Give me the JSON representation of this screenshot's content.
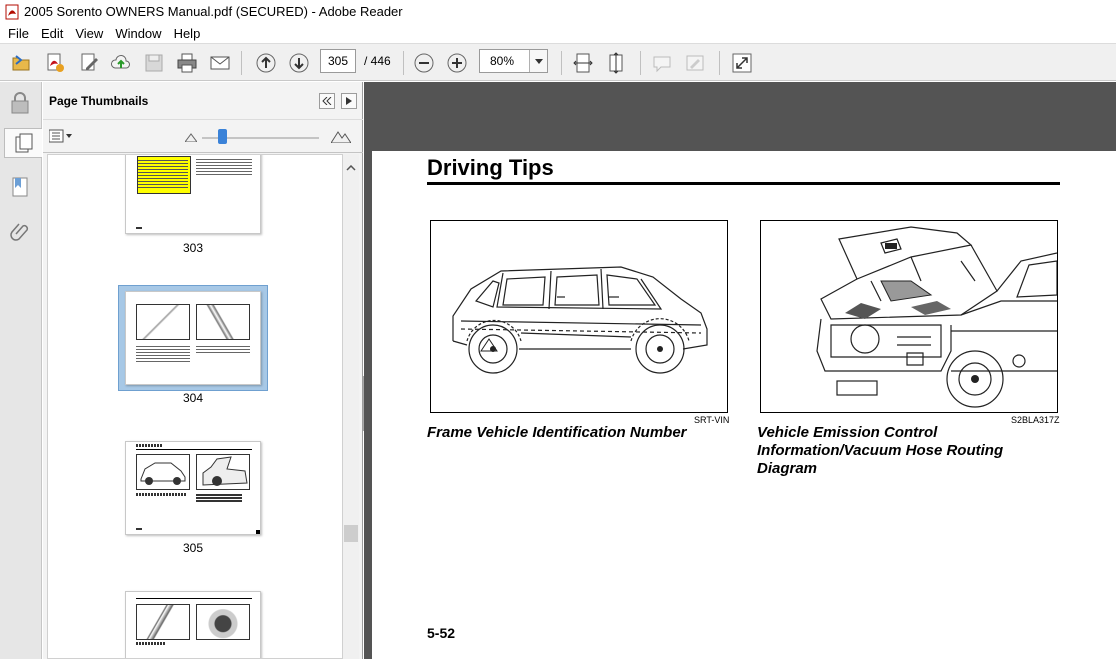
{
  "window": {
    "title": "2005 Sorento OWNERS Manual.pdf (SECURED) - Adobe Reader"
  },
  "menu": [
    "File",
    "Edit",
    "View",
    "Window",
    "Help"
  ],
  "toolbar": {
    "page_current": "305",
    "page_total": "/ 446",
    "zoom": "80%",
    "icons": [
      "open-icon",
      "create-pdf-icon",
      "edit-icon",
      "upload-cloud-icon",
      "save-icon",
      "print-icon",
      "email-icon",
      "previous-page-icon",
      "next-page-icon",
      "zoom-out-icon",
      "zoom-in-icon",
      "fit-width-icon",
      "fit-page-icon",
      "comment-icon",
      "sign-icon",
      "fullscreen-icon"
    ]
  },
  "panel": {
    "title": "Page Thumbnails",
    "thumbnails": [
      {
        "label": "303"
      },
      {
        "label": "304",
        "selected": true
      },
      {
        "label": "305"
      },
      {
        "label": ""
      }
    ]
  },
  "page": {
    "heading": "Driving Tips",
    "figures": [
      {
        "code": "SRT-VIN",
        "caption": "Frame Vehicle Identification Number"
      },
      {
        "code": "S2BLA317Z",
        "caption": "Vehicle Emission Control Information/Vacuum Hose Routing Diagram"
      }
    ],
    "page_number": "5-52"
  },
  "colors": {
    "doc_background": "#545454",
    "selected_thumb": "#a7c8e6",
    "warning_yellow": "#ffff00"
  }
}
